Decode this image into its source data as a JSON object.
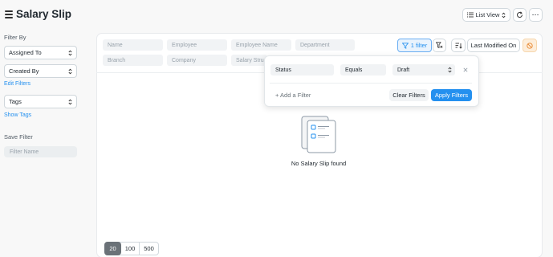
{
  "header": {
    "title": "Salary Slip",
    "list_view_label": "List View",
    "more_label": "···"
  },
  "sidebar": {
    "filter_by_label": "Filter By",
    "assigned_to": "Assigned To",
    "created_by": "Created By",
    "edit_filters": "Edit Filters",
    "tags": "Tags",
    "show_tags": "Show Tags",
    "save_filter_label": "Save Filter",
    "filter_name_placeholder": "Filter Name"
  },
  "filters": {
    "row1": [
      "Name",
      "Employee",
      "Employee Name",
      "Department"
    ],
    "row2": [
      "Branch",
      "Company",
      "Salary Structure"
    ]
  },
  "toolbar": {
    "filter_count_label": "1 filter",
    "sort_label": "Last Modified On"
  },
  "popover": {
    "field": "Status",
    "condition": "Equals",
    "value": "Draft",
    "add_filter": "+ Add a Filter",
    "clear_filters": "Clear Filters",
    "apply_filters": "Apply Filters"
  },
  "empty_state": {
    "message": "No Salary Slip found"
  },
  "paging": {
    "options": [
      "20",
      "100",
      "500"
    ],
    "selected": "20"
  },
  "colors": {
    "accent": "#2490ef",
    "selected_page": "#6b7278"
  }
}
